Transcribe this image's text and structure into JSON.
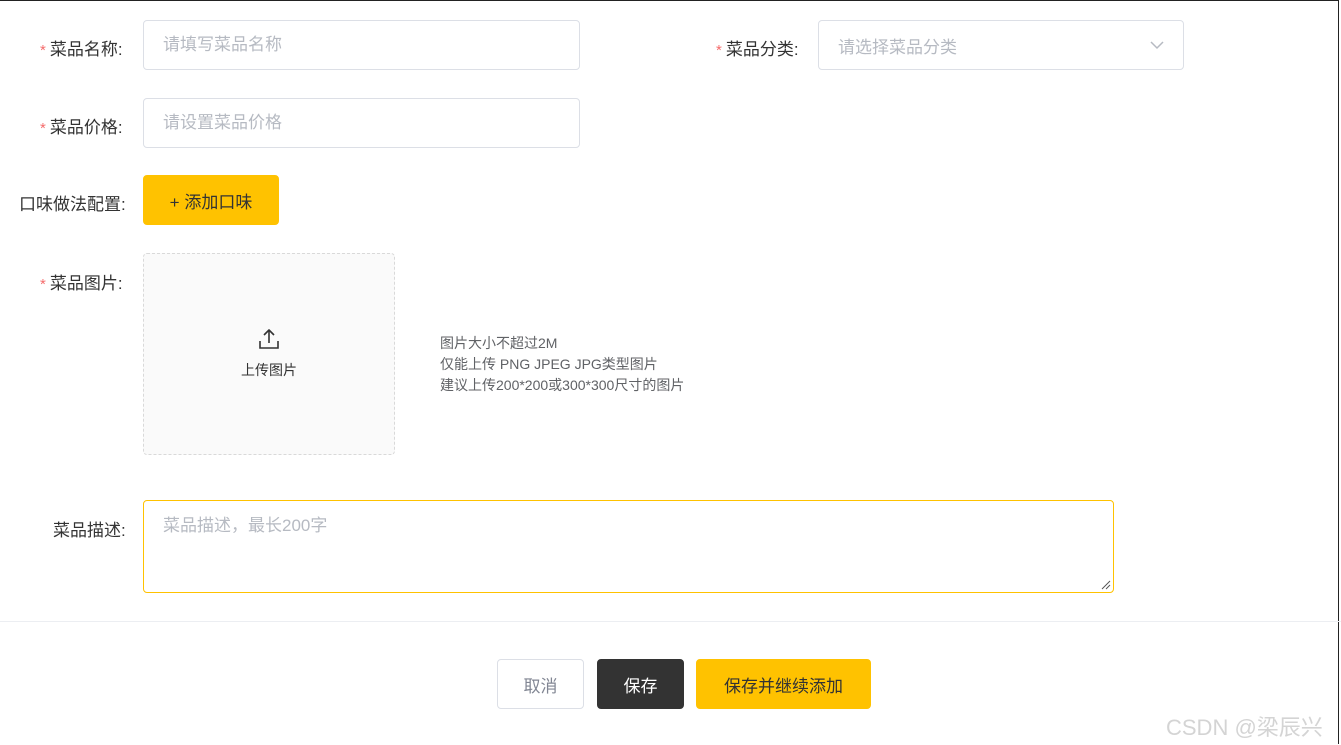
{
  "form": {
    "name": {
      "required_mark": "*",
      "label": "菜品名称:",
      "placeholder": "请填写菜品名称",
      "value": ""
    },
    "category": {
      "required_mark": "*",
      "label": "菜品分类:",
      "placeholder": "请选择菜品分类"
    },
    "price": {
      "required_mark": "*",
      "label": "菜品价格:",
      "placeholder": "请设置菜品价格",
      "value": ""
    },
    "flavor": {
      "label": "口味做法配置:",
      "add_button": "+ 添加口味"
    },
    "image": {
      "required_mark": "*",
      "label": "菜品图片:",
      "upload_text": "上传图片",
      "upload_icon": "upload-icon",
      "tips": [
        "图片大小不超过2M",
        "仅能上传 PNG JPEG JPG类型图片",
        "建议上传200*200或300*300尺寸的图片"
      ]
    },
    "description": {
      "label": "菜品描述:",
      "placeholder": "菜品描述，最长200字",
      "value": ""
    }
  },
  "footer": {
    "cancel": "取消",
    "save": "保存",
    "save_continue": "保存并继续添加"
  },
  "watermark": "CSDN @梁辰兴",
  "colors": {
    "accent": "#ffc200",
    "dark": "#333333",
    "required": "#f56c6c",
    "border": "#dcdfe6"
  }
}
